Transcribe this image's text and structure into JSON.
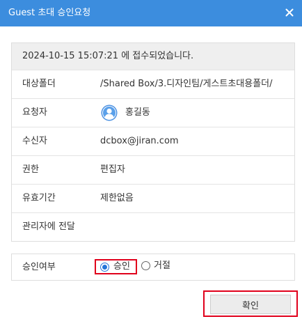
{
  "dialog": {
    "title": "Guest 초대 승인요청",
    "close_icon": "close-icon"
  },
  "info": {
    "received_message": "2024-10-15 15:07:21 에 접수되었습니다.",
    "rows": [
      {
        "label": "대상폴더",
        "value": "/Shared Box/3.디자인팀/게스트초대용폴더/"
      },
      {
        "label": "요청자",
        "value": "홍길동",
        "icon": "user-avatar-icon"
      },
      {
        "label": "수신자",
        "value": "dcbox@jiran.com"
      },
      {
        "label": "권한",
        "value": "편집자"
      },
      {
        "label": "유효기간",
        "value": "제한없음"
      },
      {
        "label": "관리자에 전달",
        "value": ""
      }
    ]
  },
  "approval": {
    "label": "승인여부",
    "options": [
      {
        "label": "승인",
        "selected": true
      },
      {
        "label": "거절",
        "selected": false
      }
    ]
  },
  "footer": {
    "confirm_label": "확인"
  },
  "colors": {
    "titlebar": "#3c8dde",
    "highlight_box": "#e0001b",
    "radio_selected": "#2574d9"
  }
}
